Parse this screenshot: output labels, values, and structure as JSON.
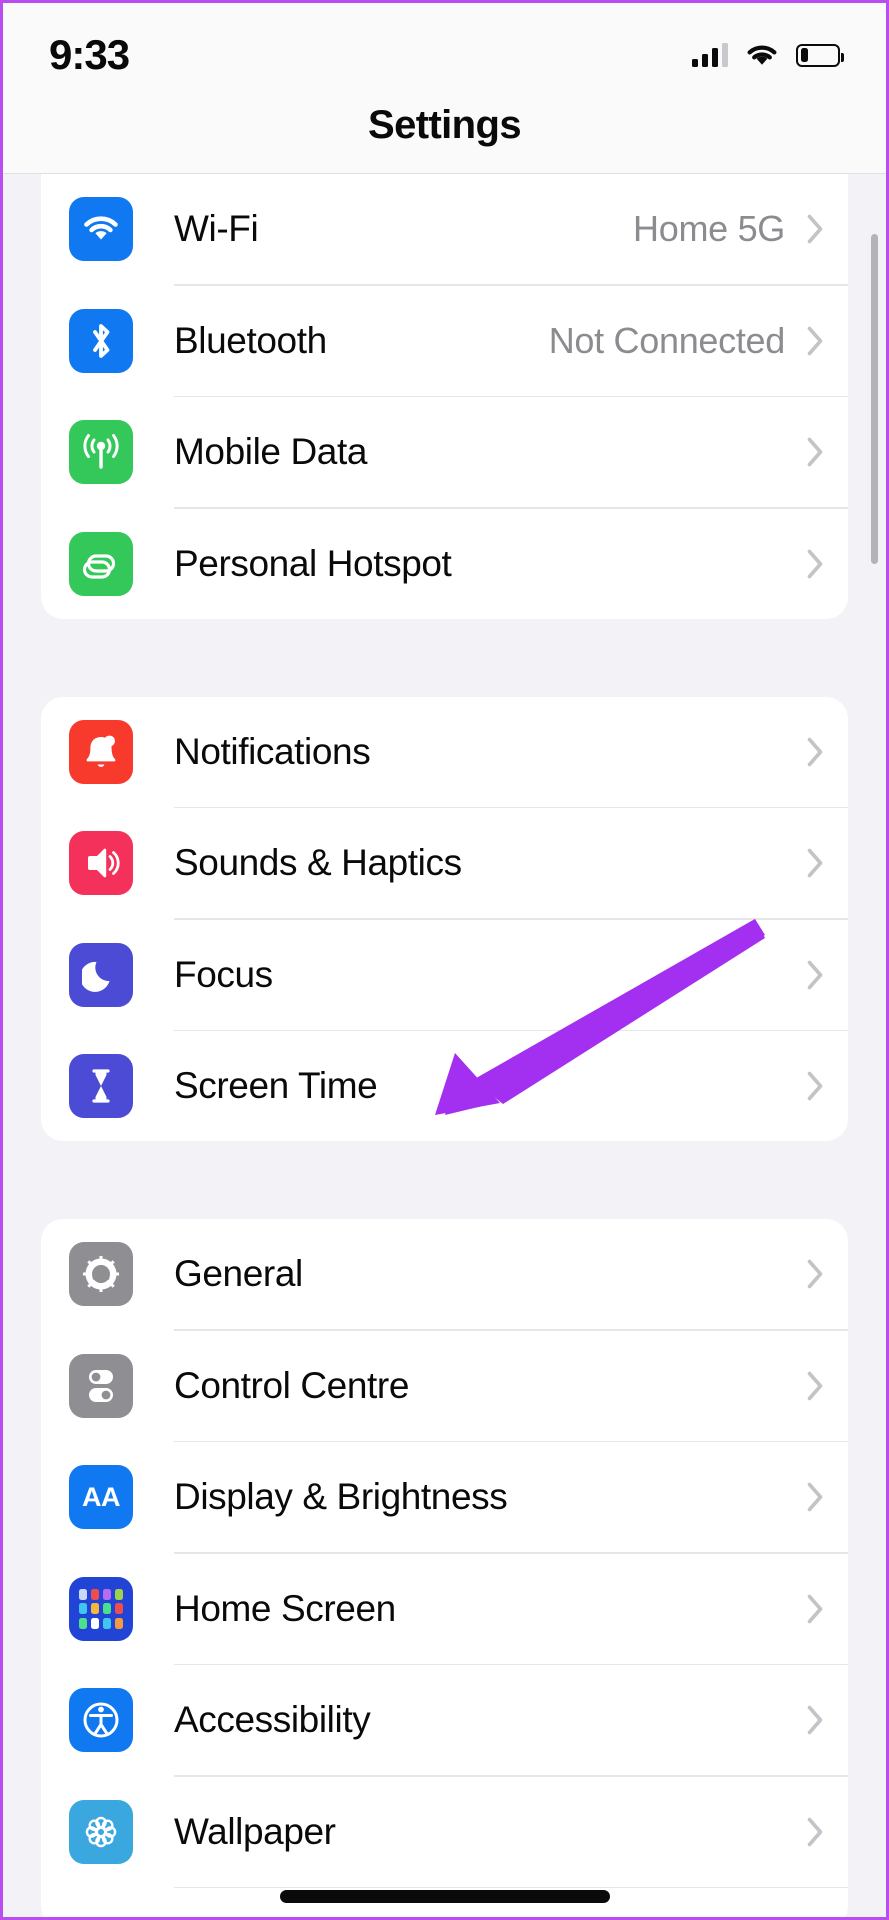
{
  "status_bar": {
    "time": "9:33",
    "signal_icon": "cellular-bars-icon",
    "wifi_icon": "wifi-icon",
    "battery_icon": "battery-low-icon",
    "battery_level_percent": 20
  },
  "nav": {
    "title": "Settings"
  },
  "groups": [
    {
      "id": "connectivity",
      "rows": [
        {
          "label": "Wi-Fi",
          "value": "Home 5G",
          "icon": "wifi-icon",
          "icon_color": "#1079f2",
          "chevron": true
        },
        {
          "label": "Bluetooth",
          "value": "Not Connected",
          "icon": "bluetooth-icon",
          "icon_color": "#1079f2",
          "chevron": true
        },
        {
          "label": "Mobile Data",
          "value": "",
          "icon": "cellular-antenna-icon",
          "icon_color": "#34c759",
          "chevron": true
        },
        {
          "label": "Personal Hotspot",
          "value": "",
          "icon": "hotspot-links-icon",
          "icon_color": "#34c759",
          "chevron": true
        }
      ]
    },
    {
      "id": "alerts",
      "rows": [
        {
          "label": "Notifications",
          "value": "",
          "icon": "bell-icon",
          "icon_color": "#f83a2c",
          "chevron": true
        },
        {
          "label": "Sounds & Haptics",
          "value": "",
          "icon": "speaker-icon",
          "icon_color": "#f4315a",
          "chevron": true
        },
        {
          "label": "Focus",
          "value": "",
          "icon": "moon-icon",
          "icon_color": "#4b4bd6",
          "chevron": true
        },
        {
          "label": "Screen Time",
          "value": "",
          "icon": "hourglass-icon",
          "icon_color": "#4b4bd6",
          "chevron": true
        }
      ]
    },
    {
      "id": "system",
      "rows": [
        {
          "label": "General",
          "value": "",
          "icon": "gear-icon",
          "icon_color": "#8e8e93",
          "chevron": true
        },
        {
          "label": "Control Centre",
          "value": "",
          "icon": "toggles-icon",
          "icon_color": "#8e8e93",
          "chevron": true
        },
        {
          "label": "Display & Brightness",
          "value": "",
          "icon": "text-size-aa-icon",
          "icon_color": "#1079f2",
          "chevron": true
        },
        {
          "label": "Home Screen",
          "value": "",
          "icon": "app-grid-icon",
          "icon_color": "#2244d6",
          "chevron": true
        },
        {
          "label": "Accessibility",
          "value": "",
          "icon": "accessibility-icon",
          "icon_color": "#1079f2",
          "chevron": true
        },
        {
          "label": "Wallpaper",
          "value": "",
          "icon": "flower-icon",
          "icon_color": "#3aa8de",
          "chevron": true
        }
      ]
    }
  ],
  "annotation": {
    "arrow_color": "#a32ff0",
    "points_to": "Screen Time"
  },
  "colors": {
    "page_background": "#f2f2f7",
    "card_background": "#ffffff",
    "primary_text": "#0a0a0a",
    "secondary_text": "#8b8b90",
    "divider": "#e6e6ea",
    "frame_border": "#b84df0"
  }
}
